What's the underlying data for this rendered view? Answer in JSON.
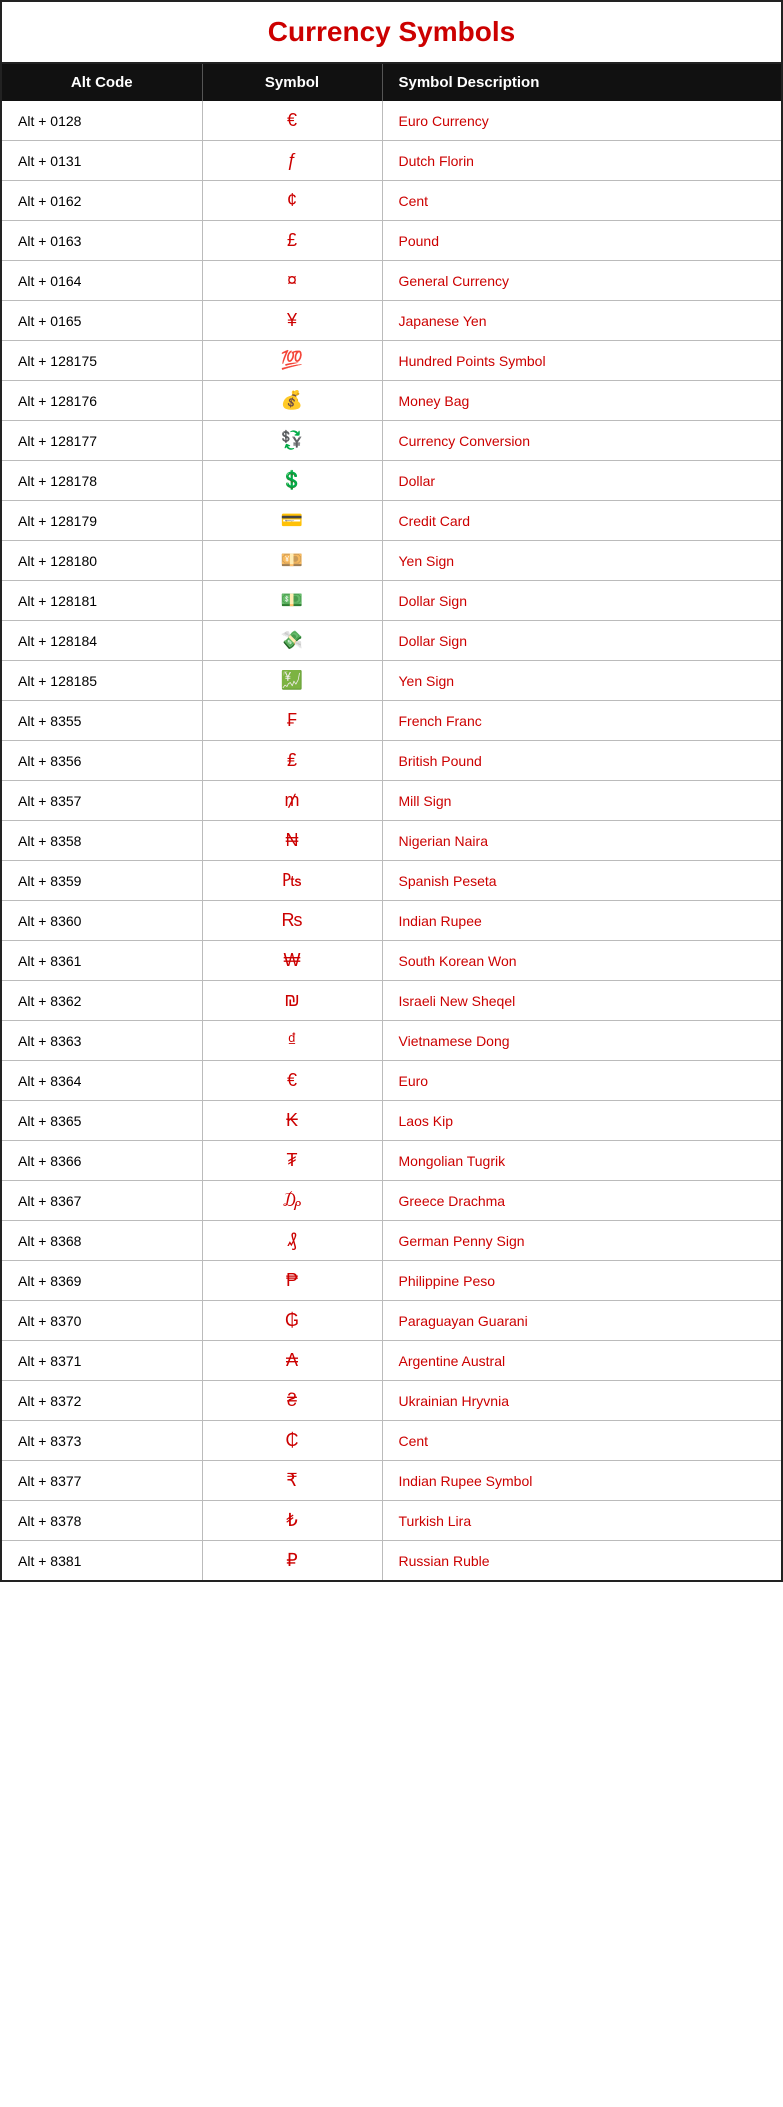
{
  "title": "Currency Symbols",
  "headers": [
    "Alt Code",
    "Symbol",
    "Symbol Description"
  ],
  "rows": [
    {
      "altcode": "Alt + 0128",
      "symbol": "€",
      "description": "Euro Currency"
    },
    {
      "altcode": "Alt + 0131",
      "symbol": "ƒ",
      "description": "Dutch Florin"
    },
    {
      "altcode": "Alt + 0162",
      "symbol": "¢",
      "description": "Cent"
    },
    {
      "altcode": "Alt + 0163",
      "symbol": "£",
      "description": "Pound"
    },
    {
      "altcode": "Alt + 0164",
      "symbol": "¤",
      "description": "General Currency"
    },
    {
      "altcode": "Alt + 0165",
      "symbol": "¥",
      "description": "Japanese Yen"
    },
    {
      "altcode": "Alt + 128175",
      "symbol": "💯",
      "description": "Hundred Points Symbol"
    },
    {
      "altcode": "Alt + 128176",
      "symbol": "💰",
      "description": "Money Bag"
    },
    {
      "altcode": "Alt + 128177",
      "symbol": "💱",
      "description": "Currency Conversion"
    },
    {
      "altcode": "Alt + 128178",
      "symbol": "💲",
      "description": "Dollar"
    },
    {
      "altcode": "Alt + 128179",
      "symbol": "💳",
      "description": "Credit Card"
    },
    {
      "altcode": "Alt + 128180",
      "symbol": "💴",
      "description": "Yen Sign"
    },
    {
      "altcode": "Alt + 128181",
      "symbol": "💵",
      "description": "Dollar Sign"
    },
    {
      "altcode": "Alt + 128184",
      "symbol": "💸",
      "description": "Dollar Sign"
    },
    {
      "altcode": "Alt + 128185",
      "symbol": "💹",
      "description": "Yen Sign"
    },
    {
      "altcode": "Alt + 8355",
      "symbol": "₣",
      "description": "French Franc"
    },
    {
      "altcode": "Alt + 8356",
      "symbol": "₤",
      "description": "British Pound"
    },
    {
      "altcode": "Alt + 8357",
      "symbol": "₥",
      "description": "Mill Sign"
    },
    {
      "altcode": "Alt + 8358",
      "symbol": "₦",
      "description": "Nigerian Naira"
    },
    {
      "altcode": "Alt + 8359",
      "symbol": "₧",
      "description": "Spanish Peseta"
    },
    {
      "altcode": "Alt + 8360",
      "symbol": "₨",
      "description": "Indian Rupee"
    },
    {
      "altcode": "Alt + 8361",
      "symbol": "₩",
      "description": "South Korean Won"
    },
    {
      "altcode": "Alt + 8362",
      "symbol": "₪",
      "description": "Israeli New Sheqel"
    },
    {
      "altcode": "Alt + 8363",
      "symbol": "₫",
      "description": "Vietnamese Dong"
    },
    {
      "altcode": "Alt + 8364",
      "symbol": "€",
      "description": "Euro"
    },
    {
      "altcode": "Alt + 8365",
      "symbol": "₭",
      "description": "Laos Kip"
    },
    {
      "altcode": "Alt + 8366",
      "symbol": "₮",
      "description": "Mongolian Tugrik"
    },
    {
      "altcode": "Alt + 8367",
      "symbol": "₯",
      "description": "Greece Drachma"
    },
    {
      "altcode": "Alt + 8368",
      "symbol": "₰",
      "description": "German Penny  Sign"
    },
    {
      "altcode": "Alt + 8369",
      "symbol": "₱",
      "description": "Philippine Peso"
    },
    {
      "altcode": "Alt + 8370",
      "symbol": "₲",
      "description": "Paraguayan Guarani"
    },
    {
      "altcode": "Alt + 8371",
      "symbol": "₳",
      "description": "Argentine Austral"
    },
    {
      "altcode": "Alt + 8372",
      "symbol": "₴",
      "description": "Ukrainian Hryvnia"
    },
    {
      "altcode": "Alt + 8373",
      "symbol": "₵",
      "description": "Cent"
    },
    {
      "altcode": "Alt + 8377",
      "symbol": "₹",
      "description": "Indian Rupee Symbol"
    },
    {
      "altcode": "Alt + 8378",
      "symbol": "₺",
      "description": "Turkish Lira"
    },
    {
      "altcode": "Alt + 8381",
      "symbol": "₽",
      "description": "Russian Ruble"
    }
  ]
}
